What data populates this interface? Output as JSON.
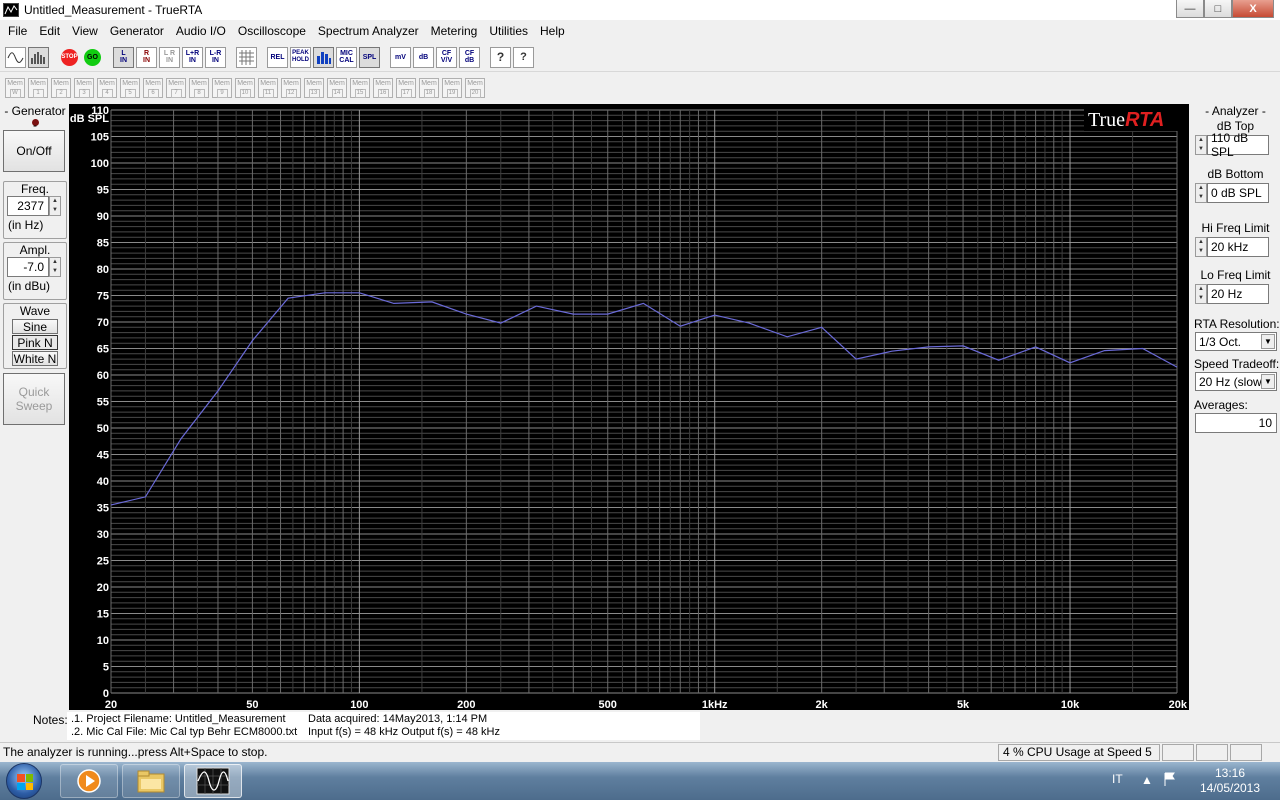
{
  "window": {
    "title": "Untitled_Measurement - TrueRTA",
    "minimize": "—",
    "maximize": "□",
    "close": "X"
  },
  "menu": [
    "File",
    "Edit",
    "View",
    "Generator",
    "Audio I/O",
    "Oscilloscope",
    "Spectrum Analyzer",
    "Metering",
    "Utilities",
    "Help"
  ],
  "toolbar": {
    "stop": "STOP",
    "go": "GO",
    "l_in": "L\nIN",
    "r_in": "R\nIN",
    "l_r_in": "L R\nIN",
    "lpr_in": "L+R\nIN",
    "lmr_in": "L-R\nIN",
    "rel": "REL",
    "peak_hold": "PEAK\nHOLD",
    "mic_cal": "MIC\nCAL",
    "spl": "SPL",
    "mv": "mV",
    "db": "dB",
    "cf_vv": "CF\nV/V",
    "cf_db": "CF\ndB",
    "help": "?",
    "whats_this": "?"
  },
  "mem_buttons": [
    "W",
    "1",
    "2",
    "3",
    "4",
    "5",
    "6",
    "7",
    "8",
    "9",
    "10",
    "11",
    "12",
    "13",
    "14",
    "15",
    "16",
    "17",
    "18",
    "19",
    "20"
  ],
  "mem_label": "Mem",
  "generator": {
    "title": "- Generator -",
    "on_off": "On/Off",
    "freq_title": "Freq.",
    "freq_value": "2377",
    "freq_unit": "(in Hz)",
    "ampl_title": "Ampl.",
    "ampl_value": "-7.0",
    "ampl_unit": "(in dBu)",
    "wave_title": "Wave",
    "waves": [
      "Sine",
      "Pink N",
      "White N"
    ],
    "quick_sweep": "Quick\nSweep"
  },
  "analyzer": {
    "title": "- Analyzer -",
    "db_top_label": "dB Top",
    "db_top_value": "110 dB SPL",
    "db_bottom_label": "dB Bottom",
    "db_bottom_value": "0 dB SPL",
    "hi_freq_label": "Hi Freq Limit",
    "hi_freq_value": "20 kHz",
    "lo_freq_label": "Lo Freq Limit",
    "lo_freq_value": "20 Hz",
    "rta_res_label": "RTA Resolution:",
    "rta_res_value": "1/3 Oct.",
    "speed_label": "Speed Tradeoff:",
    "speed_value": "20 Hz (slow)",
    "averages_label": "Averages:",
    "averages_value": "10"
  },
  "chart_data": {
    "type": "line",
    "ylabel": "dB SPL",
    "ylim": [
      0,
      110
    ],
    "xlim": [
      20,
      20000
    ],
    "xscale": "log",
    "logo": "TrueRTA",
    "y_ticks": [
      0,
      5,
      10,
      15,
      20,
      25,
      30,
      35,
      40,
      45,
      50,
      55,
      60,
      65,
      70,
      75,
      80,
      85,
      90,
      95,
      100,
      105,
      110
    ],
    "x_ticks": [
      {
        "value": 20,
        "label": "20"
      },
      {
        "value": 50,
        "label": "50"
      },
      {
        "value": 100,
        "label": "100"
      },
      {
        "value": 200,
        "label": "200"
      },
      {
        "value": 500,
        "label": "500"
      },
      {
        "value": 1000,
        "label": "1kHz"
      },
      {
        "value": 2000,
        "label": "2k"
      },
      {
        "value": 5000,
        "label": "5k"
      },
      {
        "value": 10000,
        "label": "10k"
      },
      {
        "value": 20000,
        "label": "20k"
      }
    ],
    "grid": true,
    "line_color": "#6a6ad8",
    "series": [
      {
        "x": [
          20,
          25,
          31.5,
          40,
          50,
          63,
          80,
          100,
          125,
          160,
          200,
          250,
          315,
          400,
          500,
          630,
          800,
          1000,
          1250,
          1600,
          2000,
          2500,
          3150,
          4000,
          5000,
          6300,
          8000,
          10000,
          12500,
          16000,
          20000
        ],
        "y": [
          35.5,
          37,
          48,
          57,
          66.5,
          74.5,
          75.5,
          75.5,
          73.5,
          73.8,
          71.5,
          69.8,
          73,
          71.5,
          71.5,
          73.5,
          69.2,
          71.3,
          69.8,
          67.2,
          69,
          63,
          64.5,
          65.3,
          65.5,
          62.8,
          65.3,
          62.3,
          64.6,
          65,
          61.5
        ]
      }
    ]
  },
  "notes": {
    "label": "Notes:",
    "line1_a": ".1. Project Filename: Untitled_Measurement",
    "line1_b": "Data acquired: 14May2013, 1:14 PM",
    "line2_a": ".2. Mic Cal File: Mic Cal typ Behr ECM8000.txt",
    "line2_b": "Input f(s) = 48 kHz   Output f(s) = 48 kHz"
  },
  "status": {
    "text": "The analyzer is running...press Alt+Space to stop.",
    "cpu": "4 % CPU Usage at Speed 5"
  },
  "taskbar": {
    "lang": "IT",
    "time": "13:16",
    "date": "14/05/2013"
  }
}
